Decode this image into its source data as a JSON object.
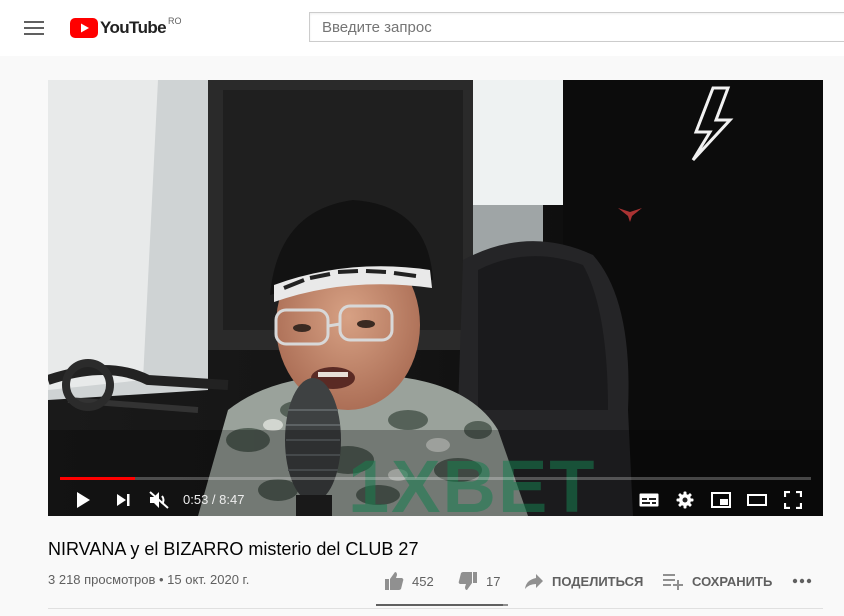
{
  "header": {
    "logo_text": "YouTube",
    "country_code": "RO",
    "search_placeholder": "Введите запрос",
    "icons": [
      "menu-icon",
      "youtube-logo-icon"
    ]
  },
  "player": {
    "time_current": "0:53",
    "time_separator": " / ",
    "time_total": "8:47",
    "progress_played": 0.1,
    "progress_loaded": 0.1,
    "muted": true,
    "icons": [
      "play-icon",
      "next-icon",
      "mute-icon",
      "subtitles-icon",
      "settings-gear-icon",
      "miniplayer-icon",
      "theater-mode-icon",
      "fullscreen-icon"
    ],
    "overlay_text": "1XBET",
    "headband_text": "KARDAMENT"
  },
  "video": {
    "title": "NIRVANA y el BIZARRO misterio del CLUB 27",
    "views": "3 218 просмотров",
    "date_separator": " • ",
    "date": "15 окт. 2020 г.",
    "likes": "452",
    "dislikes": "17",
    "share_label": "ПОДЕЛИТЬСЯ",
    "save_label": "СОХРАНИТЬ",
    "like_ratio": 0.964
  },
  "colors": {
    "brand_red": "#ff0000",
    "page_bg": "#f9f9f9",
    "text_secondary": "#606060"
  }
}
